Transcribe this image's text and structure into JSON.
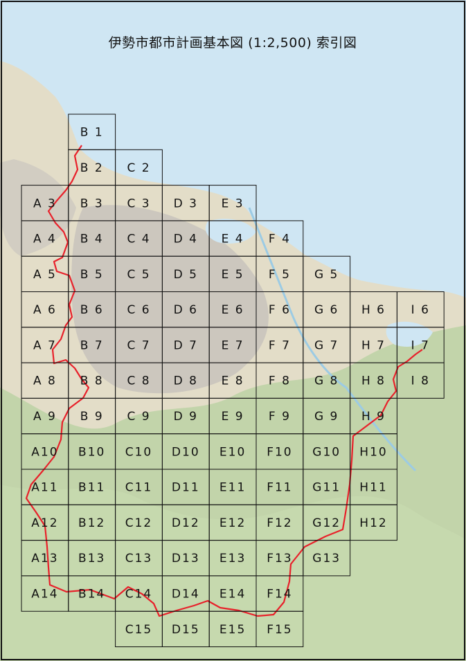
{
  "title": "伊勢市都市計画基本図 (1:2,500) 索引図",
  "colors": {
    "sea": "#cfe6f3",
    "land": "#e3ddc8",
    "forest": "#bcd2a4",
    "urban": "#c9c4bc",
    "boundary": "#e8202a",
    "grid": "#111111"
  },
  "grid": {
    "columns": [
      "A",
      "B",
      "C",
      "D",
      "E",
      "F",
      "G",
      "H",
      "I"
    ],
    "rows": [
      1,
      2,
      3,
      4,
      5,
      6,
      7,
      8,
      9,
      10,
      11,
      12,
      13,
      14,
      15
    ],
    "sheets": [
      {
        "label": "B 1",
        "col": "B",
        "row": 1
      },
      {
        "label": "B 2",
        "col": "B",
        "row": 2
      },
      {
        "label": "C 2",
        "col": "C",
        "row": 2
      },
      {
        "label": "A 3",
        "col": "A",
        "row": 3
      },
      {
        "label": "B 3",
        "col": "B",
        "row": 3
      },
      {
        "label": "C 3",
        "col": "C",
        "row": 3
      },
      {
        "label": "D 3",
        "col": "D",
        "row": 3
      },
      {
        "label": "E 3",
        "col": "E",
        "row": 3
      },
      {
        "label": "A 4",
        "col": "A",
        "row": 4
      },
      {
        "label": "B 4",
        "col": "B",
        "row": 4
      },
      {
        "label": "C 4",
        "col": "C",
        "row": 4
      },
      {
        "label": "D 4",
        "col": "D",
        "row": 4
      },
      {
        "label": "E 4",
        "col": "E",
        "row": 4
      },
      {
        "label": "F 4",
        "col": "F",
        "row": 4
      },
      {
        "label": "A 5",
        "col": "A",
        "row": 5
      },
      {
        "label": "B 5",
        "col": "B",
        "row": 5
      },
      {
        "label": "C 5",
        "col": "C",
        "row": 5
      },
      {
        "label": "D 5",
        "col": "D",
        "row": 5
      },
      {
        "label": "E 5",
        "col": "E",
        "row": 5
      },
      {
        "label": "F 5",
        "col": "F",
        "row": 5
      },
      {
        "label": "G 5",
        "col": "G",
        "row": 5
      },
      {
        "label": "A 6",
        "col": "A",
        "row": 6
      },
      {
        "label": "B 6",
        "col": "B",
        "row": 6
      },
      {
        "label": "C 6",
        "col": "C",
        "row": 6
      },
      {
        "label": "D 6",
        "col": "D",
        "row": 6
      },
      {
        "label": "E 6",
        "col": "E",
        "row": 6
      },
      {
        "label": "F 6",
        "col": "F",
        "row": 6
      },
      {
        "label": "G 6",
        "col": "G",
        "row": 6
      },
      {
        "label": "H 6",
        "col": "H",
        "row": 6
      },
      {
        "label": "I 6",
        "col": "I",
        "row": 6
      },
      {
        "label": "A 7",
        "col": "A",
        "row": 7
      },
      {
        "label": "B 7",
        "col": "B",
        "row": 7
      },
      {
        "label": "C 7",
        "col": "C",
        "row": 7
      },
      {
        "label": "D 7",
        "col": "D",
        "row": 7
      },
      {
        "label": "E 7",
        "col": "E",
        "row": 7
      },
      {
        "label": "F 7",
        "col": "F",
        "row": 7
      },
      {
        "label": "G 7",
        "col": "G",
        "row": 7
      },
      {
        "label": "H 7",
        "col": "H",
        "row": 7
      },
      {
        "label": "I 7",
        "col": "I",
        "row": 7
      },
      {
        "label": "A 8",
        "col": "A",
        "row": 8
      },
      {
        "label": "B 8",
        "col": "B",
        "row": 8
      },
      {
        "label": "C 8",
        "col": "C",
        "row": 8
      },
      {
        "label": "D 8",
        "col": "D",
        "row": 8
      },
      {
        "label": "E 8",
        "col": "E",
        "row": 8
      },
      {
        "label": "F 8",
        "col": "F",
        "row": 8
      },
      {
        "label": "G 8",
        "col": "G",
        "row": 8
      },
      {
        "label": "H 8",
        "col": "H",
        "row": 8
      },
      {
        "label": "I 8",
        "col": "I",
        "row": 8
      },
      {
        "label": "A 9",
        "col": "A",
        "row": 9
      },
      {
        "label": "B 9",
        "col": "B",
        "row": 9
      },
      {
        "label": "C 9",
        "col": "C",
        "row": 9
      },
      {
        "label": "D 9",
        "col": "D",
        "row": 9
      },
      {
        "label": "E 9",
        "col": "E",
        "row": 9
      },
      {
        "label": "F 9",
        "col": "F",
        "row": 9
      },
      {
        "label": "G 9",
        "col": "G",
        "row": 9
      },
      {
        "label": "H 9",
        "col": "H",
        "row": 9
      },
      {
        "label": "A10",
        "col": "A",
        "row": 10
      },
      {
        "label": "B10",
        "col": "B",
        "row": 10
      },
      {
        "label": "C10",
        "col": "C",
        "row": 10
      },
      {
        "label": "D10",
        "col": "D",
        "row": 10
      },
      {
        "label": "E10",
        "col": "E",
        "row": 10
      },
      {
        "label": "F10",
        "col": "F",
        "row": 10
      },
      {
        "label": "G10",
        "col": "G",
        "row": 10
      },
      {
        "label": "H10",
        "col": "H",
        "row": 10
      },
      {
        "label": "A11",
        "col": "A",
        "row": 11
      },
      {
        "label": "B11",
        "col": "B",
        "row": 11
      },
      {
        "label": "C11",
        "col": "C",
        "row": 11
      },
      {
        "label": "D11",
        "col": "D",
        "row": 11
      },
      {
        "label": "E11",
        "col": "E",
        "row": 11
      },
      {
        "label": "F11",
        "col": "F",
        "row": 11
      },
      {
        "label": "G11",
        "col": "G",
        "row": 11
      },
      {
        "label": "H11",
        "col": "H",
        "row": 11
      },
      {
        "label": "A12",
        "col": "A",
        "row": 12
      },
      {
        "label": "B12",
        "col": "B",
        "row": 12
      },
      {
        "label": "C12",
        "col": "C",
        "row": 12
      },
      {
        "label": "D12",
        "col": "D",
        "row": 12
      },
      {
        "label": "E12",
        "col": "E",
        "row": 12
      },
      {
        "label": "F12",
        "col": "F",
        "row": 12
      },
      {
        "label": "G12",
        "col": "G",
        "row": 12
      },
      {
        "label": "H12",
        "col": "H",
        "row": 12
      },
      {
        "label": "A13",
        "col": "A",
        "row": 13
      },
      {
        "label": "B13",
        "col": "B",
        "row": 13
      },
      {
        "label": "C13",
        "col": "C",
        "row": 13
      },
      {
        "label": "D13",
        "col": "D",
        "row": 13
      },
      {
        "label": "E13",
        "col": "E",
        "row": 13
      },
      {
        "label": "F13",
        "col": "F",
        "row": 13
      },
      {
        "label": "G13",
        "col": "G",
        "row": 13
      },
      {
        "label": "A14",
        "col": "A",
        "row": 14
      },
      {
        "label": "B14",
        "col": "B",
        "row": 14
      },
      {
        "label": "C14",
        "col": "C",
        "row": 14
      },
      {
        "label": "D14",
        "col": "D",
        "row": 14
      },
      {
        "label": "E14",
        "col": "E",
        "row": 14
      },
      {
        "label": "F14",
        "col": "F",
        "row": 14
      },
      {
        "label": "C15",
        "col": "C",
        "row": 15
      },
      {
        "label": "D15",
        "col": "D",
        "row": 15
      },
      {
        "label": "E15",
        "col": "E",
        "row": 15
      },
      {
        "label": "F15",
        "col": "F",
        "row": 15
      }
    ]
  }
}
